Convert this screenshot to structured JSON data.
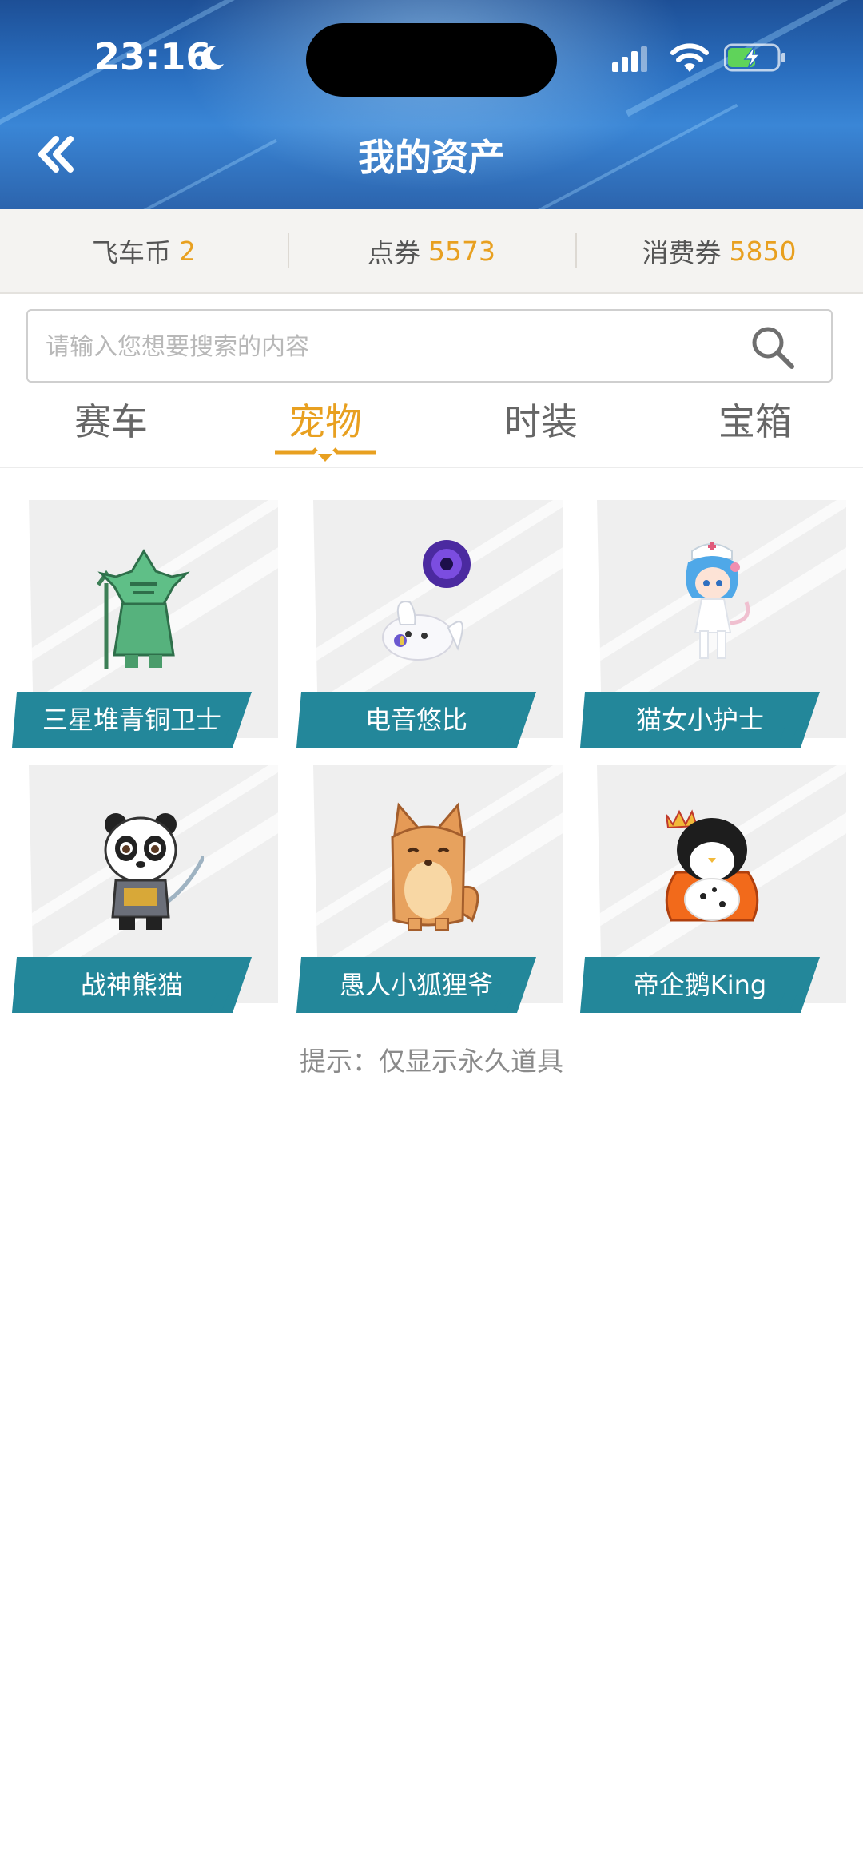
{
  "status_bar": {
    "time": "23:16"
  },
  "header": {
    "title": "我的资产"
  },
  "currency": [
    {
      "label": "飞车币",
      "value": "2"
    },
    {
      "label": "点券",
      "value": "5573"
    },
    {
      "label": "消费券",
      "value": "5850"
    }
  ],
  "search": {
    "placeholder": "请输入您想要搜索的内容",
    "value": ""
  },
  "tabs": [
    {
      "label": "赛车",
      "active": false
    },
    {
      "label": "宠物",
      "active": true
    },
    {
      "label": "时装",
      "active": false
    },
    {
      "label": "宝箱",
      "active": false
    }
  ],
  "pets": [
    {
      "name": "三星堆青铜卫士",
      "icon": "bronze-guardian-pet-icon"
    },
    {
      "name": "电音悠比",
      "icon": "purple-bunny-pet-icon"
    },
    {
      "name": "猫女小护士",
      "icon": "nurse-cat-girl-pet-icon"
    },
    {
      "name": "战神熊猫",
      "icon": "warrior-panda-pet-icon"
    },
    {
      "name": "愚人小狐狸爷",
      "icon": "fox-pet-icon"
    },
    {
      "name": "帝企鹅King",
      "icon": "king-penguin-pet-icon"
    }
  ],
  "hint": "提示：仅显示永久道具",
  "colors": {
    "accent": "#e8a020",
    "label_bg": "#23879a",
    "header_bg": "#2a6fc0"
  }
}
